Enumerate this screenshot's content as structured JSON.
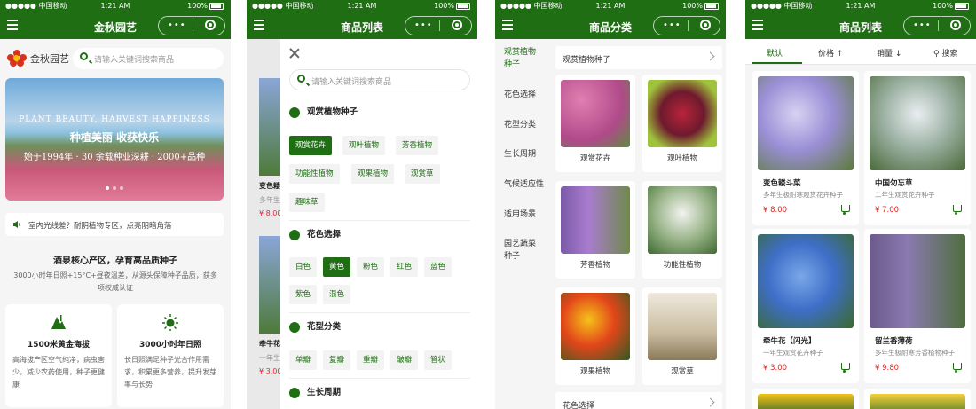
{
  "colors": {
    "accent": "#1f6e14",
    "price": "#e02323"
  },
  "status": {
    "carrier": "●●●●● 中国移动",
    "time": "1:21 AM",
    "battery": "100%"
  },
  "screen1": {
    "title": "金秋园艺",
    "brand": "金秋园艺",
    "search_placeholder": "请输入关键词搜索商品",
    "banner_en": "PLANT BEAUTY, HARVEST HAPPINESS",
    "banner_cn": "种植美丽 收获快乐",
    "banner_sub": "始于1994年 · 30 余载种业深耕 · 2000+品种",
    "notice": "室内光线差？耐阴植物专区，点亮阴暗角落",
    "section_title": "酒泉核心产区，孕育高品质种子",
    "section_desc": "3000小时年日照+15°C+昼夜温差，从源头保障种子品质，获多项权威认证",
    "cards": [
      {
        "title": "1500米黄金海拔",
        "desc": "高海拔产区空气纯净，病虫害少，减少农药使用，种子更健康",
        "icon": "mountain-icon"
      },
      {
        "title": "3000小时年日照",
        "desc": "长日照满足种子光合作用需求，积累更多营养，提升发芽率与长势",
        "icon": "sun-icon"
      }
    ]
  },
  "screen2": {
    "title": "商品列表",
    "tab_default": "默认",
    "bg_names": [
      "变色耧",
      "牵牛花"
    ],
    "bg_descs": [
      "多年生",
      "一年生"
    ],
    "bg_prices": [
      "¥ 8.00",
      "¥ 3.00"
    ],
    "search_placeholder": "请输入关键词搜索商品",
    "groups": [
      {
        "name": "观赏植物种子",
        "chips": [
          "观赏花卉",
          "观叶植物",
          "芳香植物",
          "功能性植物",
          "观果植物",
          "观赏草",
          "趣味草"
        ],
        "selected": 0
      },
      {
        "name": "花色选择",
        "chips": [
          "白色",
          "黄色",
          "粉色",
          "红色",
          "蓝色",
          "紫色",
          "混色"
        ],
        "selected": 1
      },
      {
        "name": "花型分类",
        "chips": [
          "单瓣",
          "复瓣",
          "重瓣",
          "皱瓣",
          "管状"
        ],
        "selected": -1
      },
      {
        "name": "生长周期",
        "chips": [],
        "selected": -1
      }
    ]
  },
  "screen3": {
    "title": "商品分类",
    "left": [
      "观赏植物种子",
      "花色选择",
      "花型分类",
      "生长周期",
      "气候适应性",
      "适用场景",
      "园艺蔬菜种子"
    ],
    "head1": "观赏植物种子",
    "tiles": [
      "观赏花卉",
      "观叶植物",
      "芳香植物",
      "功能性植物",
      "观果植物",
      "观赏草"
    ],
    "head2": "花色选择"
  },
  "screen4": {
    "title": "商品列表",
    "sort": [
      "默认",
      "价格 ↑",
      "销量 ↓",
      "搜索"
    ],
    "products": [
      {
        "name": "变色耧斗菜",
        "desc": "多年生极耐寒观赏花卉种子",
        "price": "¥ 8.00"
      },
      {
        "name": "中国勿忘草",
        "desc": "二年生观赏花卉种子",
        "price": "¥ 7.00"
      },
      {
        "name": "牵牛花【闪光】",
        "desc": "一年生观赏花卉种子",
        "price": "¥ 3.00"
      },
      {
        "name": "留兰香薄荷",
        "desc": "多年生极耐寒芳香植物种子",
        "price": "¥ 9.80"
      }
    ]
  }
}
